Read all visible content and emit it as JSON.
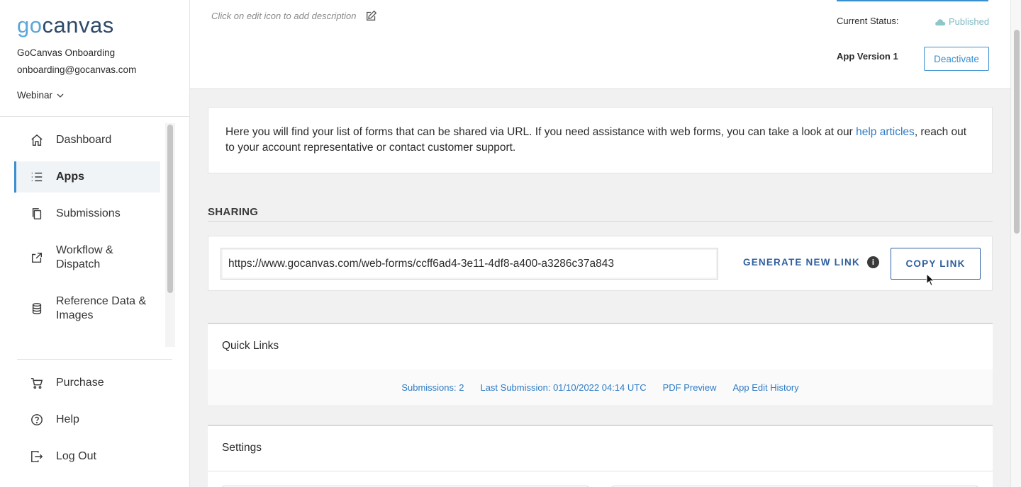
{
  "sidebar": {
    "logo_go": "go",
    "logo_rest": "canvas",
    "org_name": "GoCanvas Onboarding",
    "org_email": "onboarding@gocanvas.com",
    "workspace": "Webinar",
    "nav": [
      {
        "label": "Dashboard",
        "icon": "home-icon"
      },
      {
        "label": "Apps",
        "icon": "list-icon",
        "active": true
      },
      {
        "label": "Submissions",
        "icon": "copy-icon"
      },
      {
        "label": "Workflow & Dispatch",
        "icon": "share-icon"
      },
      {
        "label": "Reference Data & Images",
        "icon": "database-icon"
      }
    ],
    "nav_bottom": [
      {
        "label": "Purchase",
        "icon": "cart-icon"
      },
      {
        "label": "Help",
        "icon": "help-icon"
      },
      {
        "label": "Log Out",
        "icon": "logout-icon"
      }
    ]
  },
  "header": {
    "description_hint": "Click on edit icon to add description",
    "status_label": "Current Status:",
    "status_value": "Published",
    "version_label": "App Version 1",
    "deactivate_label": "Deactivate"
  },
  "info": {
    "text_before": "Here you will find your list of forms that can be shared via URL. If you need assistance with web forms, you can take a look at our ",
    "link_text": "help articles",
    "text_after": ", reach out to your account representative or contact customer support."
  },
  "sharing": {
    "title": "SHARING",
    "url": "https://www.gocanvas.com/web-forms/ccff6ad4-3e11-4df8-a400-a3286c37a843",
    "generate_label": "GENERATE NEW LINK",
    "copy_label": "COPY LINK"
  },
  "quick_links": {
    "title": "Quick Links",
    "links": [
      "Submissions: 2",
      "Last Submission: 01/10/2022 04:14 UTC",
      "PDF Preview",
      "App Edit History"
    ]
  },
  "settings": {
    "title": "Settings"
  },
  "colors": {
    "accent": "#3a8fd1",
    "link": "#2e7bc4",
    "dark_blue": "#2f5f9e",
    "published": "#7fb9c2"
  }
}
